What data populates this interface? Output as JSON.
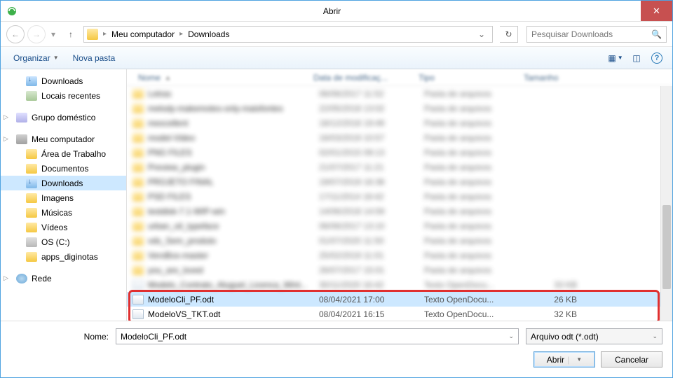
{
  "titlebar": {
    "title": "Abrir"
  },
  "nav": {
    "crumbs": [
      "Meu computador",
      "Downloads"
    ],
    "search_placeholder": "Pesquisar Downloads"
  },
  "toolbar": {
    "organize": "Organizar",
    "newfolder": "Nova pasta"
  },
  "sidebar": {
    "items": [
      {
        "label": "Downloads",
        "icon": "downloads",
        "indent": true
      },
      {
        "label": "Locais recentes",
        "icon": "recent",
        "indent": true
      },
      {
        "gap": true
      },
      {
        "label": "Grupo doméstico",
        "icon": "group",
        "exp": true
      },
      {
        "gap": true
      },
      {
        "label": "Meu computador",
        "icon": "computer",
        "exp": true
      },
      {
        "label": "Área de Trabalho",
        "icon": "folder",
        "indent": true
      },
      {
        "label": "Documentos",
        "icon": "folder",
        "indent": true
      },
      {
        "label": "Downloads",
        "icon": "downloads",
        "indent": true,
        "sel": true
      },
      {
        "label": "Imagens",
        "icon": "folder",
        "indent": true
      },
      {
        "label": "Músicas",
        "icon": "folder",
        "indent": true
      },
      {
        "label": "Vídeos",
        "icon": "folder",
        "indent": true
      },
      {
        "label": "OS (C:)",
        "icon": "drive",
        "indent": true
      },
      {
        "label": "apps_diginotas",
        "icon": "folder",
        "indent": true
      },
      {
        "gap": true
      },
      {
        "label": "Rede",
        "icon": "network",
        "exp": true
      }
    ]
  },
  "columns": {
    "name": "Nome",
    "date": "Data de modificaç...",
    "type": "Tipo",
    "size": "Tamanho"
  },
  "files": {
    "blurred": [
      {
        "name": "Letras",
        "date": "06/06/2017 11:52",
        "type": "Pasta de arquivos",
        "icon": "folder"
      },
      {
        "name": "melody-makemotes-only-maisfontes",
        "date": "22/05/2018 13:02",
        "type": "Pasta de arquivos",
        "icon": "folder"
      },
      {
        "name": "mexcellent",
        "date": "18/12/2018 19:49",
        "type": "Pasta de arquivos",
        "icon": "folder"
      },
      {
        "name": "model-Video",
        "date": "16/03/2019 10:57",
        "type": "Pasta de arquivos",
        "icon": "folder"
      },
      {
        "name": "PNG FILES",
        "date": "02/01/2015 09:13",
        "type": "Pasta de arquivos",
        "icon": "folder"
      },
      {
        "name": "Preview_plugin",
        "date": "21/07/2017 11:21",
        "type": "Pasta de arquivos",
        "icon": "folder"
      },
      {
        "name": "PROJETO FINAL",
        "date": "19/07/2019 16:38",
        "type": "Pasta de arquivos",
        "icon": "folder"
      },
      {
        "name": "PSD FILES",
        "date": "17/11/2014 18:42",
        "type": "Pasta de arquivos",
        "icon": "folder"
      },
      {
        "name": "testdisk-7.1-WIP-win",
        "date": "14/06/2018 14:59",
        "type": "Pasta de arquivos",
        "icon": "folder"
      },
      {
        "name": "urban_oil_typeface",
        "date": "06/06/2017 13:10",
        "type": "Pasta de arquivos",
        "icon": "folder"
      },
      {
        "name": "vds_Sem_produto",
        "date": "01/07/2020 11:50",
        "type": "Pasta de arquivos",
        "icon": "folder"
      },
      {
        "name": "VeroBox-master",
        "date": "25/02/2019 11:01",
        "type": "Pasta de arquivos",
        "icon": "folder"
      },
      {
        "name": "you_are_loved",
        "date": "26/07/2017 15:01",
        "type": "Pasta de arquivos",
        "icon": "folder"
      },
      {
        "name": "Modelo_Contrato_Aluguel_Licenca_Wint...",
        "date": "30/11/2020 16:42",
        "type": "Texto OpenDocu...",
        "size": "33 KB",
        "icon": "doc"
      }
    ],
    "clear": [
      {
        "name": "ModeloCli_PF.odt",
        "date": "08/04/2021 17:00",
        "type": "Texto OpenDocu...",
        "size": "26 KB",
        "icon": "doc",
        "sel": true
      },
      {
        "name": "ModeloVS_TKT.odt",
        "date": "08/04/2021 16:15",
        "type": "Texto OpenDocu...",
        "size": "32 KB",
        "icon": "doc"
      }
    ]
  },
  "bottom": {
    "name_label": "Nome:",
    "filename": "ModeloCli_PF.odt",
    "filter": "Arquivo odt (*.odt)",
    "open": "Abrir",
    "cancel": "Cancelar"
  }
}
